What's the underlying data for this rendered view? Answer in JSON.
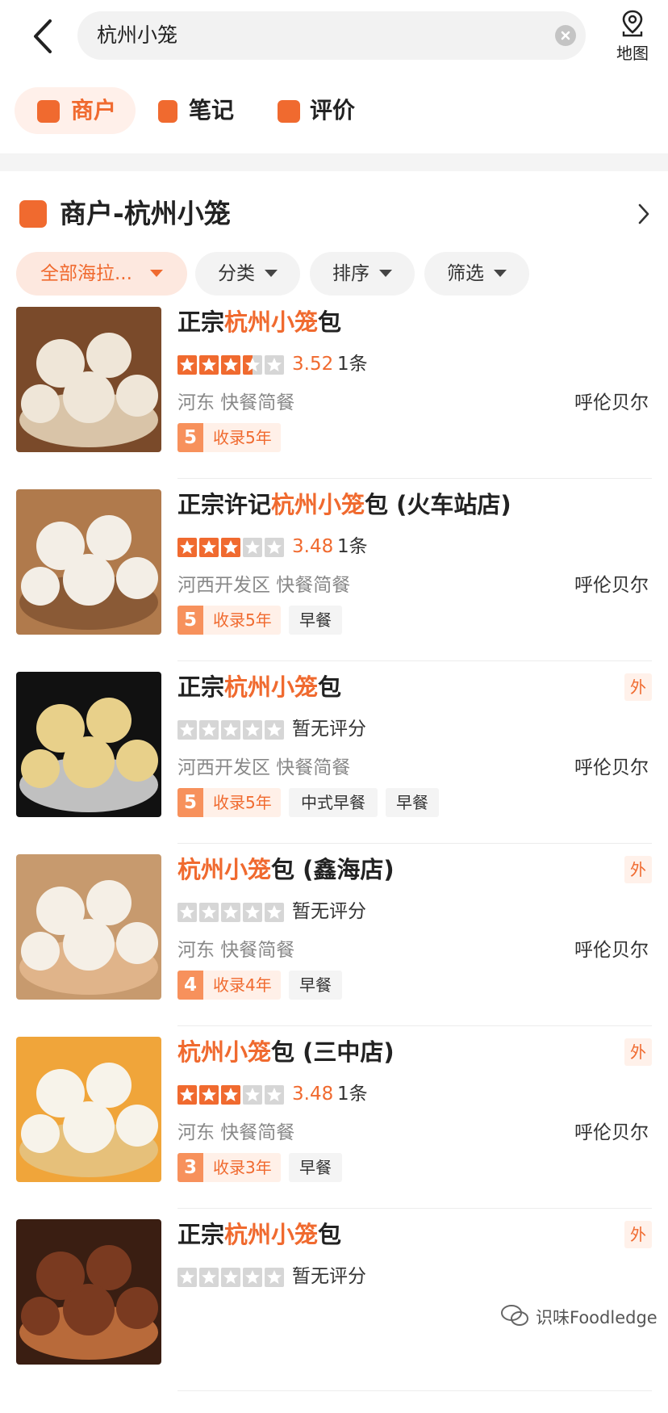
{
  "header": {
    "search_query": "杭州小笼",
    "map_label": "地图"
  },
  "tabs": [
    {
      "label": "商户",
      "active": true
    },
    {
      "label": "笔记",
      "active": false
    },
    {
      "label": "评价",
      "active": false
    }
  ],
  "section": {
    "title": "商户-杭州小笼"
  },
  "filters": [
    {
      "label": "全部海拉...",
      "active": true
    },
    {
      "label": "分类",
      "active": false
    },
    {
      "label": "排序",
      "active": false
    },
    {
      "label": "筛选",
      "active": false
    }
  ],
  "results": [
    {
      "name_pre": "正宗",
      "name_hl": "杭州小笼",
      "name_post": "包",
      "stars": 3.5,
      "score": "3.52",
      "review_count": "1条",
      "no_rating_text": "",
      "region": "河东  快餐简餐",
      "city": "呼伦贝尔",
      "years_num": "5",
      "years_text": "收录5年",
      "tags": [],
      "takeout": "",
      "photo": "steamed buns on tray"
    },
    {
      "name_pre": "正宗许记",
      "name_hl": "杭州小笼",
      "name_post": "包 (火车站店)",
      "stars": 3,
      "score": "3.48",
      "review_count": "1条",
      "no_rating_text": "",
      "region": "河西开发区  快餐简餐",
      "city": "呼伦贝尔",
      "years_num": "5",
      "years_text": "收录5年",
      "tags": [
        "早餐"
      ],
      "takeout": "",
      "photo": "buns in bamboo steamer"
    },
    {
      "name_pre": "正宗",
      "name_hl": "杭州小笼",
      "name_post": "包",
      "stars": 0,
      "score": "",
      "review_count": "",
      "no_rating_text": "暂无评分",
      "region": "河西开发区  快餐简餐",
      "city": "呼伦贝尔",
      "years_num": "5",
      "years_text": "收录5年",
      "tags": [
        "中式早餐",
        "早餐"
      ],
      "takeout": "外",
      "photo": "dumplings on steel steamer"
    },
    {
      "name_pre": "",
      "name_hl": "杭州小笼",
      "name_post": "包 (鑫海店)",
      "stars": 0,
      "score": "",
      "review_count": "",
      "no_rating_text": "暂无评分",
      "region": "河东  快餐简餐",
      "city": "呼伦贝尔",
      "years_num": "4",
      "years_text": "收录4年",
      "tags": [
        "早餐"
      ],
      "takeout": "外",
      "photo": "several steamers of dumplings"
    },
    {
      "name_pre": "",
      "name_hl": "杭州小笼",
      "name_post": "包 (三中店)",
      "stars": 3,
      "score": "3.48",
      "review_count": "1条",
      "no_rating_text": "",
      "region": "河东  快餐简餐",
      "city": "呼伦贝尔",
      "years_num": "3",
      "years_text": "收录3年",
      "tags": [
        "早餐"
      ],
      "takeout": "外",
      "photo": "buns on orange cloth"
    },
    {
      "name_pre": "正宗",
      "name_hl": "杭州小笼",
      "name_post": "包",
      "stars": 0,
      "score": "",
      "review_count": "",
      "no_rating_text": "暂无评分",
      "region": "",
      "city": "",
      "years_num": "",
      "years_text": "",
      "tags": [],
      "takeout": "外",
      "photo": "dark food photo"
    }
  ],
  "watermark": "识味Foodledge",
  "colors": {
    "accent": "#f06a2f",
    "star_on": "#f06a2f",
    "star_off": "#d6d6d6"
  },
  "icons": {
    "back": "chevron-left-icon",
    "clear": "close-circle-icon",
    "map": "map-pin-icon",
    "section_arrow": "chevron-right-icon",
    "filter_caret": "caret-down-icon"
  }
}
